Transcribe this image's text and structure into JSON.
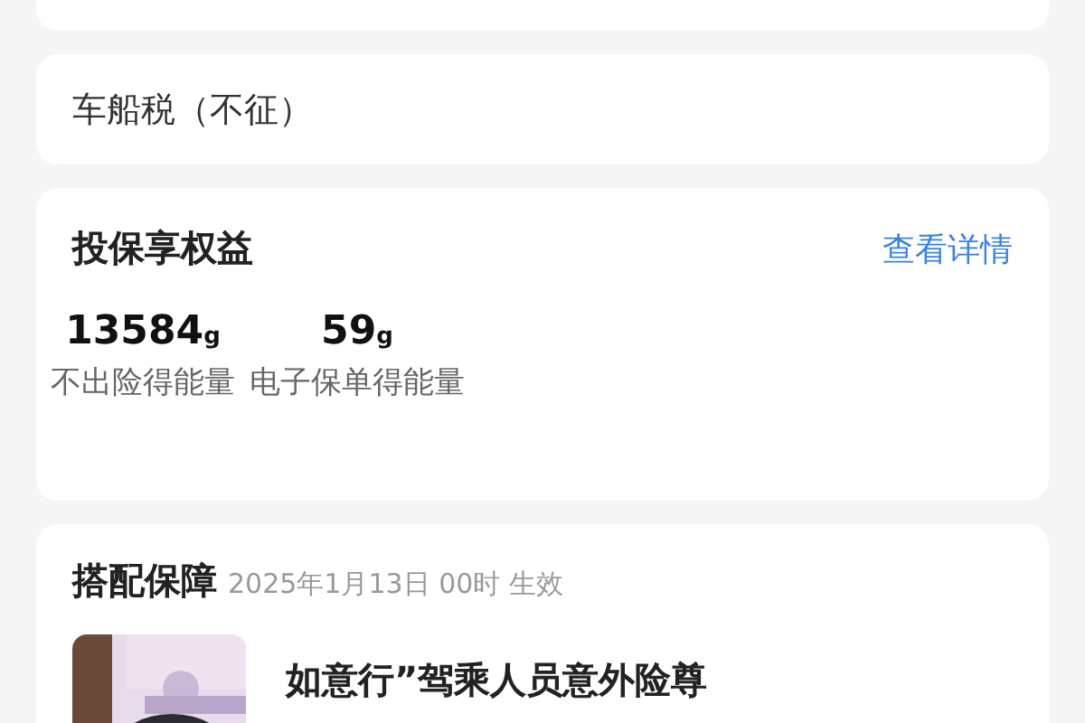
{
  "tax": {
    "label": "车船税（不征）"
  },
  "benefits": {
    "title": "投保享权益",
    "link": "查看详情",
    "stats": [
      {
        "value": "13584",
        "unit": "g",
        "label": "不出险得能量"
      },
      {
        "value": "59",
        "unit": "g",
        "label": "电子保单得能量"
      }
    ]
  },
  "bundle": {
    "title": "搭配保障",
    "effective": "2025年1月13日 00时 生效",
    "items": [
      {
        "kind": "picture",
        "name": "如意行”驾乘人员意外险尊"
      }
    ]
  }
}
